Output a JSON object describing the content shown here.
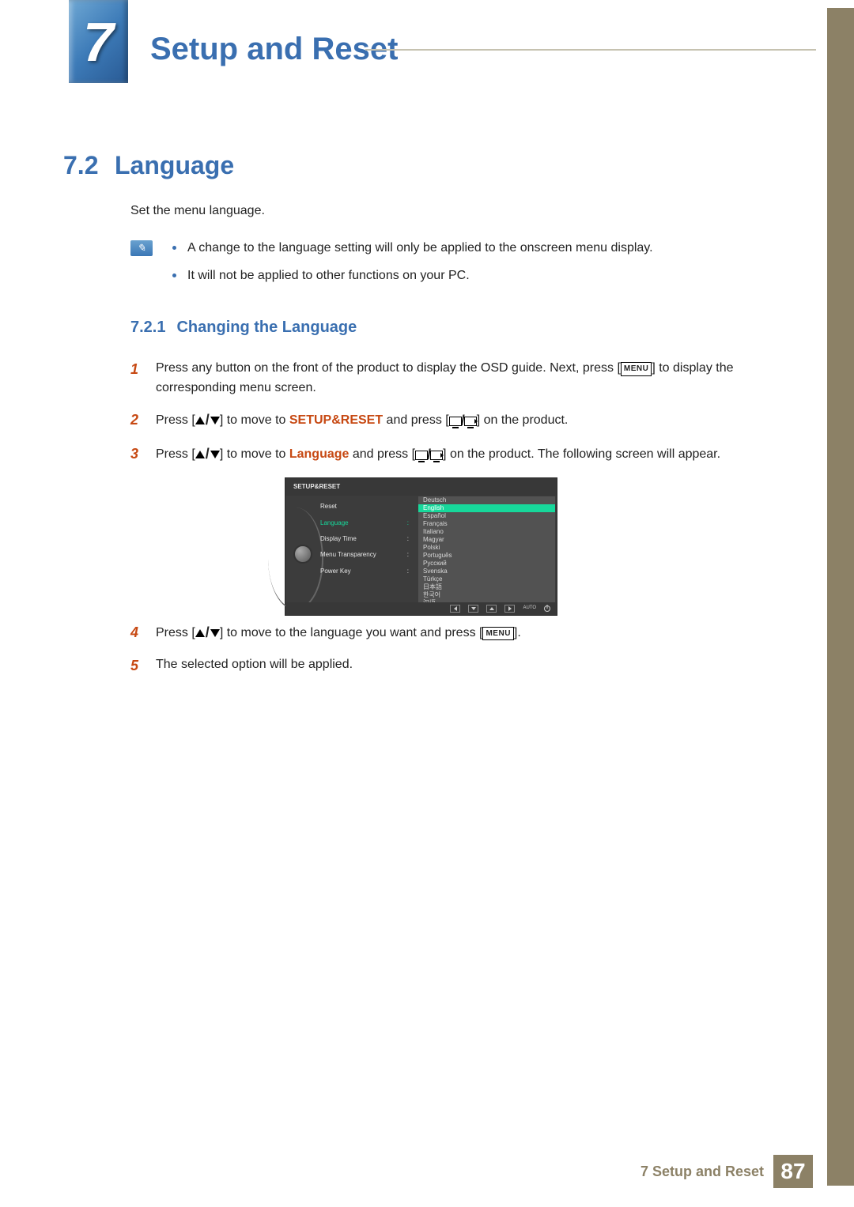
{
  "chapter": {
    "number": "7",
    "title": "Setup and Reset"
  },
  "section": {
    "number": "7.2",
    "title": "Language",
    "intro": "Set the menu language.",
    "notes": [
      "A change to the language setting will only be applied to the onscreen menu display.",
      "It will not be applied to other functions on your PC."
    ]
  },
  "subsection": {
    "number": "7.2.1",
    "title": "Changing the Language"
  },
  "steps": {
    "s1a": "Press any button on the front of the product to display the OSD guide. Next, press [",
    "s1b": "] to display the corresponding menu screen.",
    "s2a": "Press [",
    "s2b": "] to move to ",
    "s2c": "SETUP&RESET",
    "s2d": " and press [",
    "s2e": "] on the product.",
    "s3a": "Press [",
    "s3b": "] to move to ",
    "s3c": "Language",
    "s3d": " and press [",
    "s3e": "] on the product. The following screen will appear.",
    "s4a": "Press [",
    "s4b": "] to move to the language you want and press [",
    "s4c": "].",
    "s5": "The selected option will be applied."
  },
  "step_numbers": [
    "1",
    "2",
    "3",
    "4",
    "5"
  ],
  "menu_label": "MENU",
  "osd": {
    "header": "SETUP&RESET",
    "menu_items": [
      {
        "label": "Reset",
        "active": false,
        "colon": false
      },
      {
        "label": "Language",
        "active": true,
        "colon": true
      },
      {
        "label": "Display Time",
        "active": false,
        "colon": true
      },
      {
        "label": "Menu Transparency",
        "active": false,
        "colon": true
      },
      {
        "label": "Power Key",
        "active": false,
        "colon": true
      }
    ],
    "languages": [
      "Deutsch",
      "English",
      "Español",
      "Français",
      "Italiano",
      "Magyar",
      "Polski",
      "Português",
      "Русский",
      "Svenska",
      "Türkçe",
      "日本語",
      "한국어",
      "汉语"
    ],
    "selected_language_index": 1,
    "footer_auto": "AUTO"
  },
  "footer": {
    "text": "7 Setup and Reset",
    "page": "87"
  }
}
